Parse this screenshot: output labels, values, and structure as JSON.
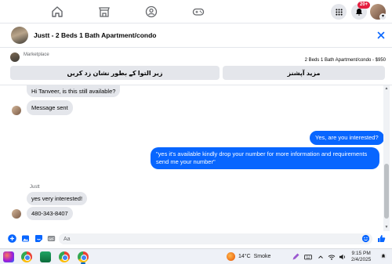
{
  "top_nav": {
    "icons": [
      "home-icon",
      "marketplace-icon",
      "groups-icon",
      "gaming-icon",
      "menu-grid-icon",
      "bell-icon"
    ],
    "notification_count": "20+",
    "active_color": "#0866ff"
  },
  "conversation": {
    "title": "Justt - 2 Beds 1 Bath Apartment/condo"
  },
  "marketplace": {
    "label": "Marketplace",
    "listing": "2 Beds 1 Bath Apartment/condo - $950",
    "buttons": [
      {
        "label": "زیر التوا کے بطور نشان زد کریں"
      },
      {
        "label": "مزید آپشنز"
      }
    ]
  },
  "messages": [
    {
      "direction": "incoming",
      "text": "Hi Tanveer, is this still available?"
    },
    {
      "direction": "incoming",
      "text": "Message sent"
    },
    {
      "direction": "outgoing",
      "text": "Yes, are you interested?"
    },
    {
      "direction": "outgoing",
      "text": "\"yes it's available kindly drop your number for more information and requirements send me your number\""
    },
    {
      "direction": "incoming",
      "sender": "Justt",
      "text": "yes very interested!"
    },
    {
      "direction": "incoming",
      "text": "480-343-8407"
    }
  ],
  "composer": {
    "placeholder": "Aa",
    "icons": [
      "plus-icon",
      "photo-icon",
      "sticker-icon",
      "gif-icon",
      "emoji-icon",
      "like-icon"
    ]
  },
  "taskbar": {
    "weather_temp": "14°C",
    "weather_desc": "Smoke",
    "time": "9:15 PM",
    "date": "2/4/2025"
  },
  "colors": {
    "brand_blue": "#0866ff",
    "bubble_gray": "#e4e6eb",
    "badge_red": "#e41e3f"
  }
}
